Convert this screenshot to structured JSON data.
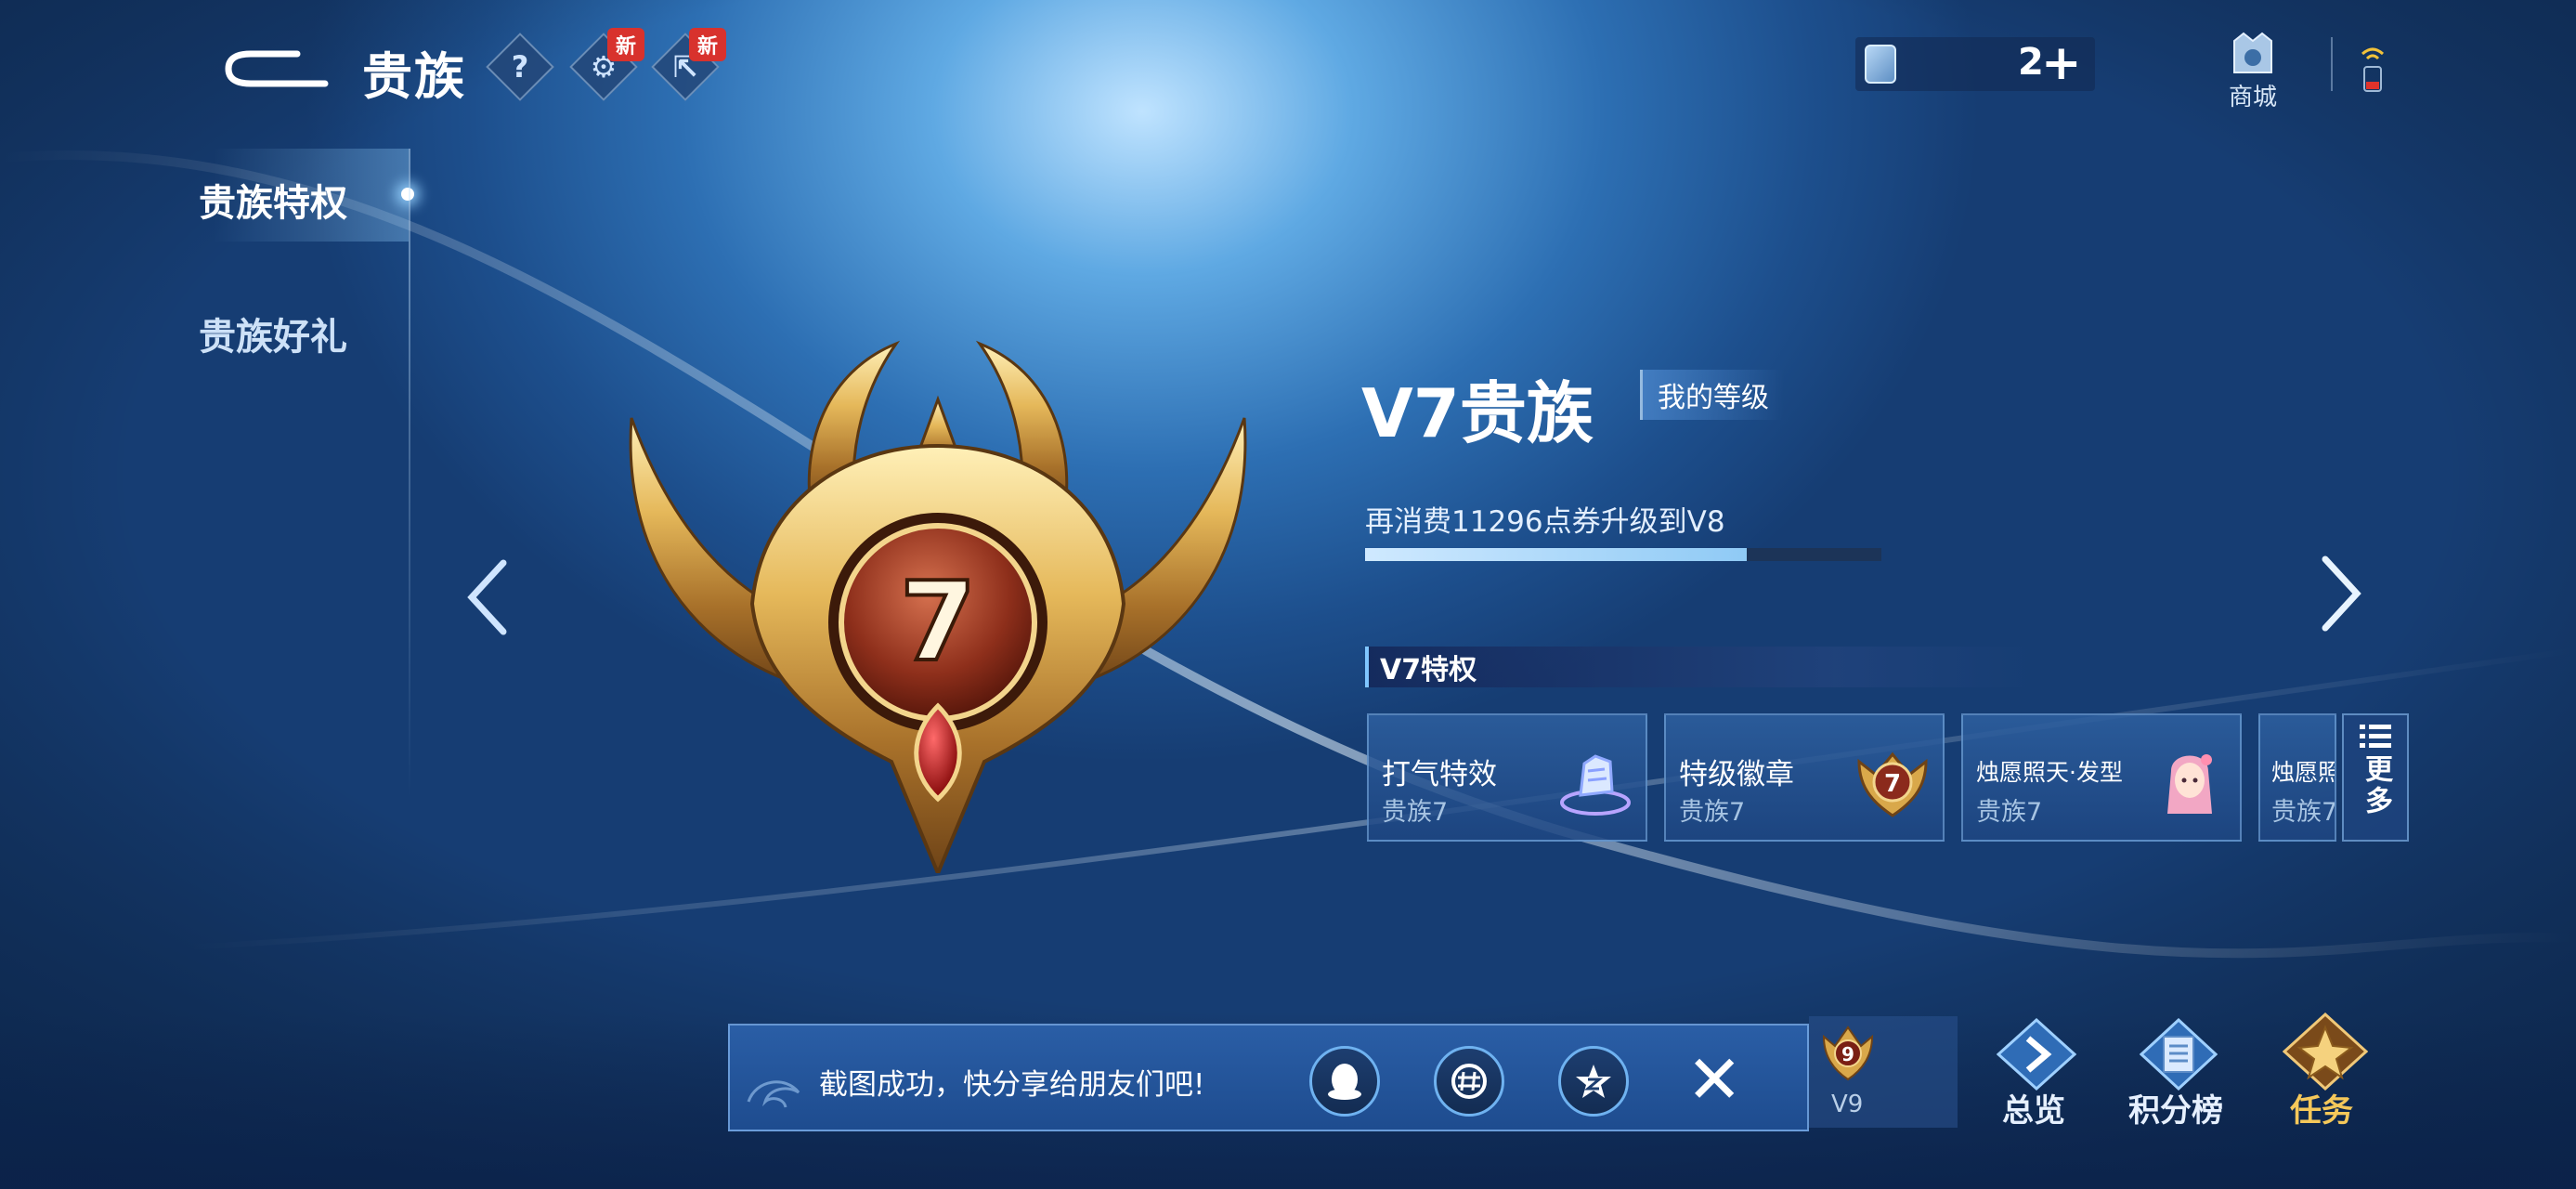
{
  "header": {
    "title": "贵族",
    "help_icon": "?",
    "settings_new_badge": "新",
    "share_new_badge": "新",
    "currency_amount": "2",
    "currency_add": "+",
    "shop_label": "商城"
  },
  "sidebar": {
    "items": [
      {
        "label": "贵族特权",
        "active": true
      },
      {
        "label": "贵族好礼",
        "active": false
      }
    ]
  },
  "badge": {
    "level_number": "7"
  },
  "info": {
    "level_title": "V7贵族",
    "my_level_label": "我的等级",
    "upgrade_text": "再消费11296点券升级到V8",
    "progress_fraction": 0.74,
    "privileges_header": "V7特权"
  },
  "privileges": [
    {
      "name": "打气特效",
      "sub": "贵族7",
      "icon": "cheer-effect-icon"
    },
    {
      "name": "特级徽章",
      "sub": "贵族7",
      "icon": "noble-badge-icon"
    },
    {
      "name": "烛愿照天·发型",
      "sub": "贵族7",
      "icon": "hairstyle-icon"
    },
    {
      "name": "烛愿照",
      "sub": "贵族7",
      "icon": "partial-card-icon"
    }
  ],
  "more_button_label": "更多",
  "bottom": {
    "v9_label": "V9",
    "v9_badge_number": "9",
    "overview_label": "总览",
    "ranking_label": "积分榜",
    "tasks_label": "任务"
  },
  "toast": {
    "message": "截图成功，快分享给朋友们吧!",
    "share_targets": [
      "qq-icon",
      "wechat-moments-icon",
      "qzone-icon"
    ],
    "close_label": "✕"
  },
  "colors": {
    "accent": "#7fc6ff",
    "gold": "#d9a84a",
    "badge_core": "#8b2a1c",
    "new_badge": "#d8322d"
  }
}
